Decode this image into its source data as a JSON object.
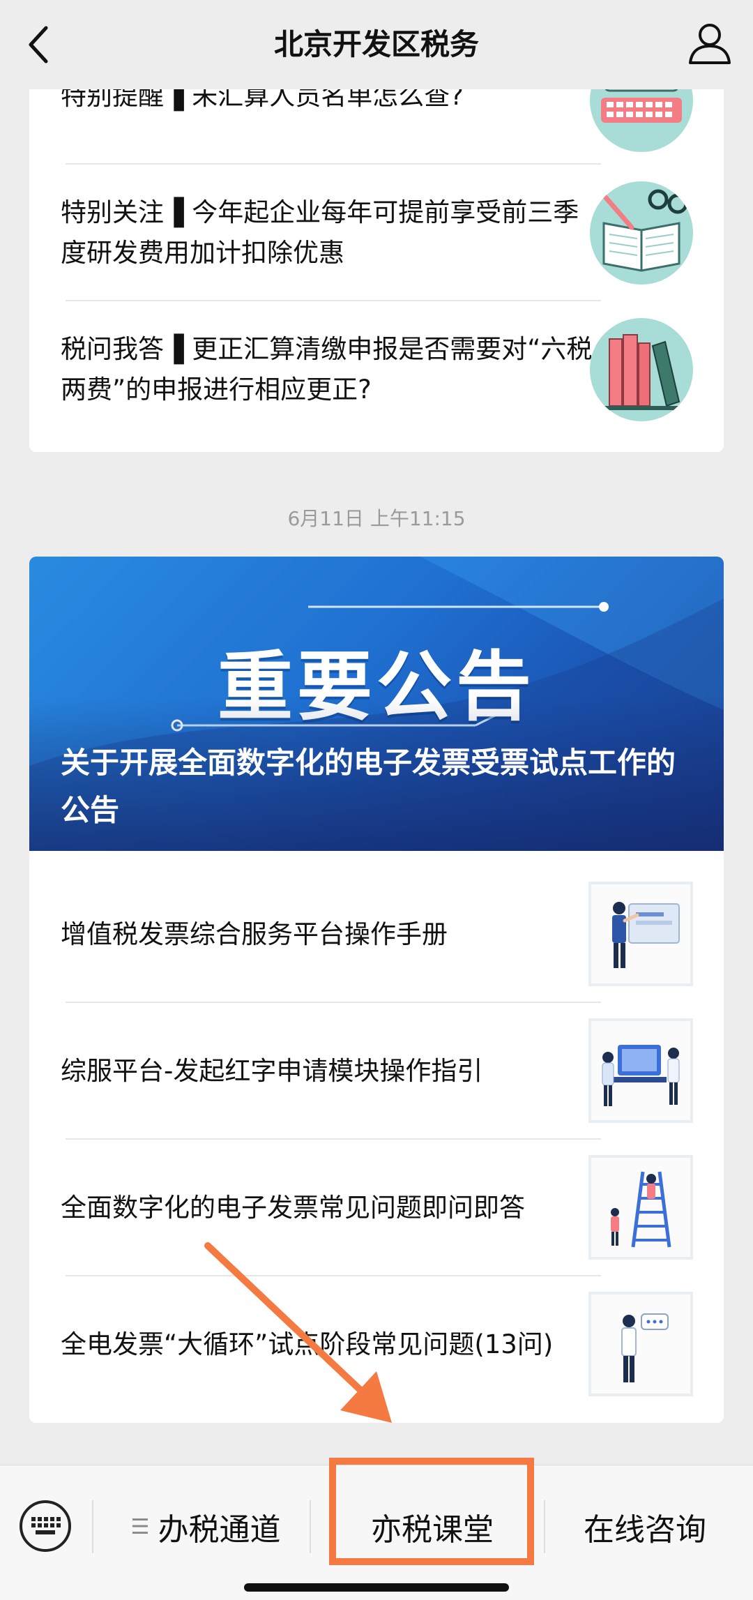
{
  "nav": {
    "title": "北京开发区税务",
    "back_icon": "chevron-left-icon",
    "profile_icon": "user-icon"
  },
  "message1": {
    "items": [
      {
        "title": "特别提醒▐ 未汇算人员名单怎么查?",
        "thumb": "keyboard-laptop-illustration"
      },
      {
        "title": "特别关注▐ 今年起企业每年可提前享受前三季度研发费用加计扣除优惠",
        "thumb": "book-glasses-illustration"
      },
      {
        "title": "税问我答▐ 更正汇算清缴申报是否需要对“六税两费”的申报进行相应更正?",
        "thumb": "books-illustration"
      }
    ]
  },
  "timestamp": "6月11日 上午11:15",
  "message2": {
    "banner": {
      "heading": "重要公告",
      "caption": "关于开展全面数字化的电子发票受票试点工作的公告"
    },
    "items": [
      {
        "title": "增值税发票综合服务平台操作手册",
        "thumb": "person-presenting-illustration"
      },
      {
        "title": "综服平台-发起红字申请模块操作指引",
        "thumb": "people-screen-illustration"
      },
      {
        "title": "全面数字化的电子发票常见问题即问即答",
        "thumb": "ladder-illustration"
      },
      {
        "title": "全电发票“大循环”试点阶段常见问题(13问)",
        "thumb": "person-chat-illustration"
      }
    ]
  },
  "bottom_bar": {
    "keyboard_icon": "keyboard-icon",
    "menus": [
      {
        "label": "办税通道",
        "icon": "menu-lines-icon"
      },
      {
        "label": "亦税课堂"
      },
      {
        "label": "在线咨询"
      }
    ]
  },
  "annotation": {
    "color": "#f47a41"
  }
}
